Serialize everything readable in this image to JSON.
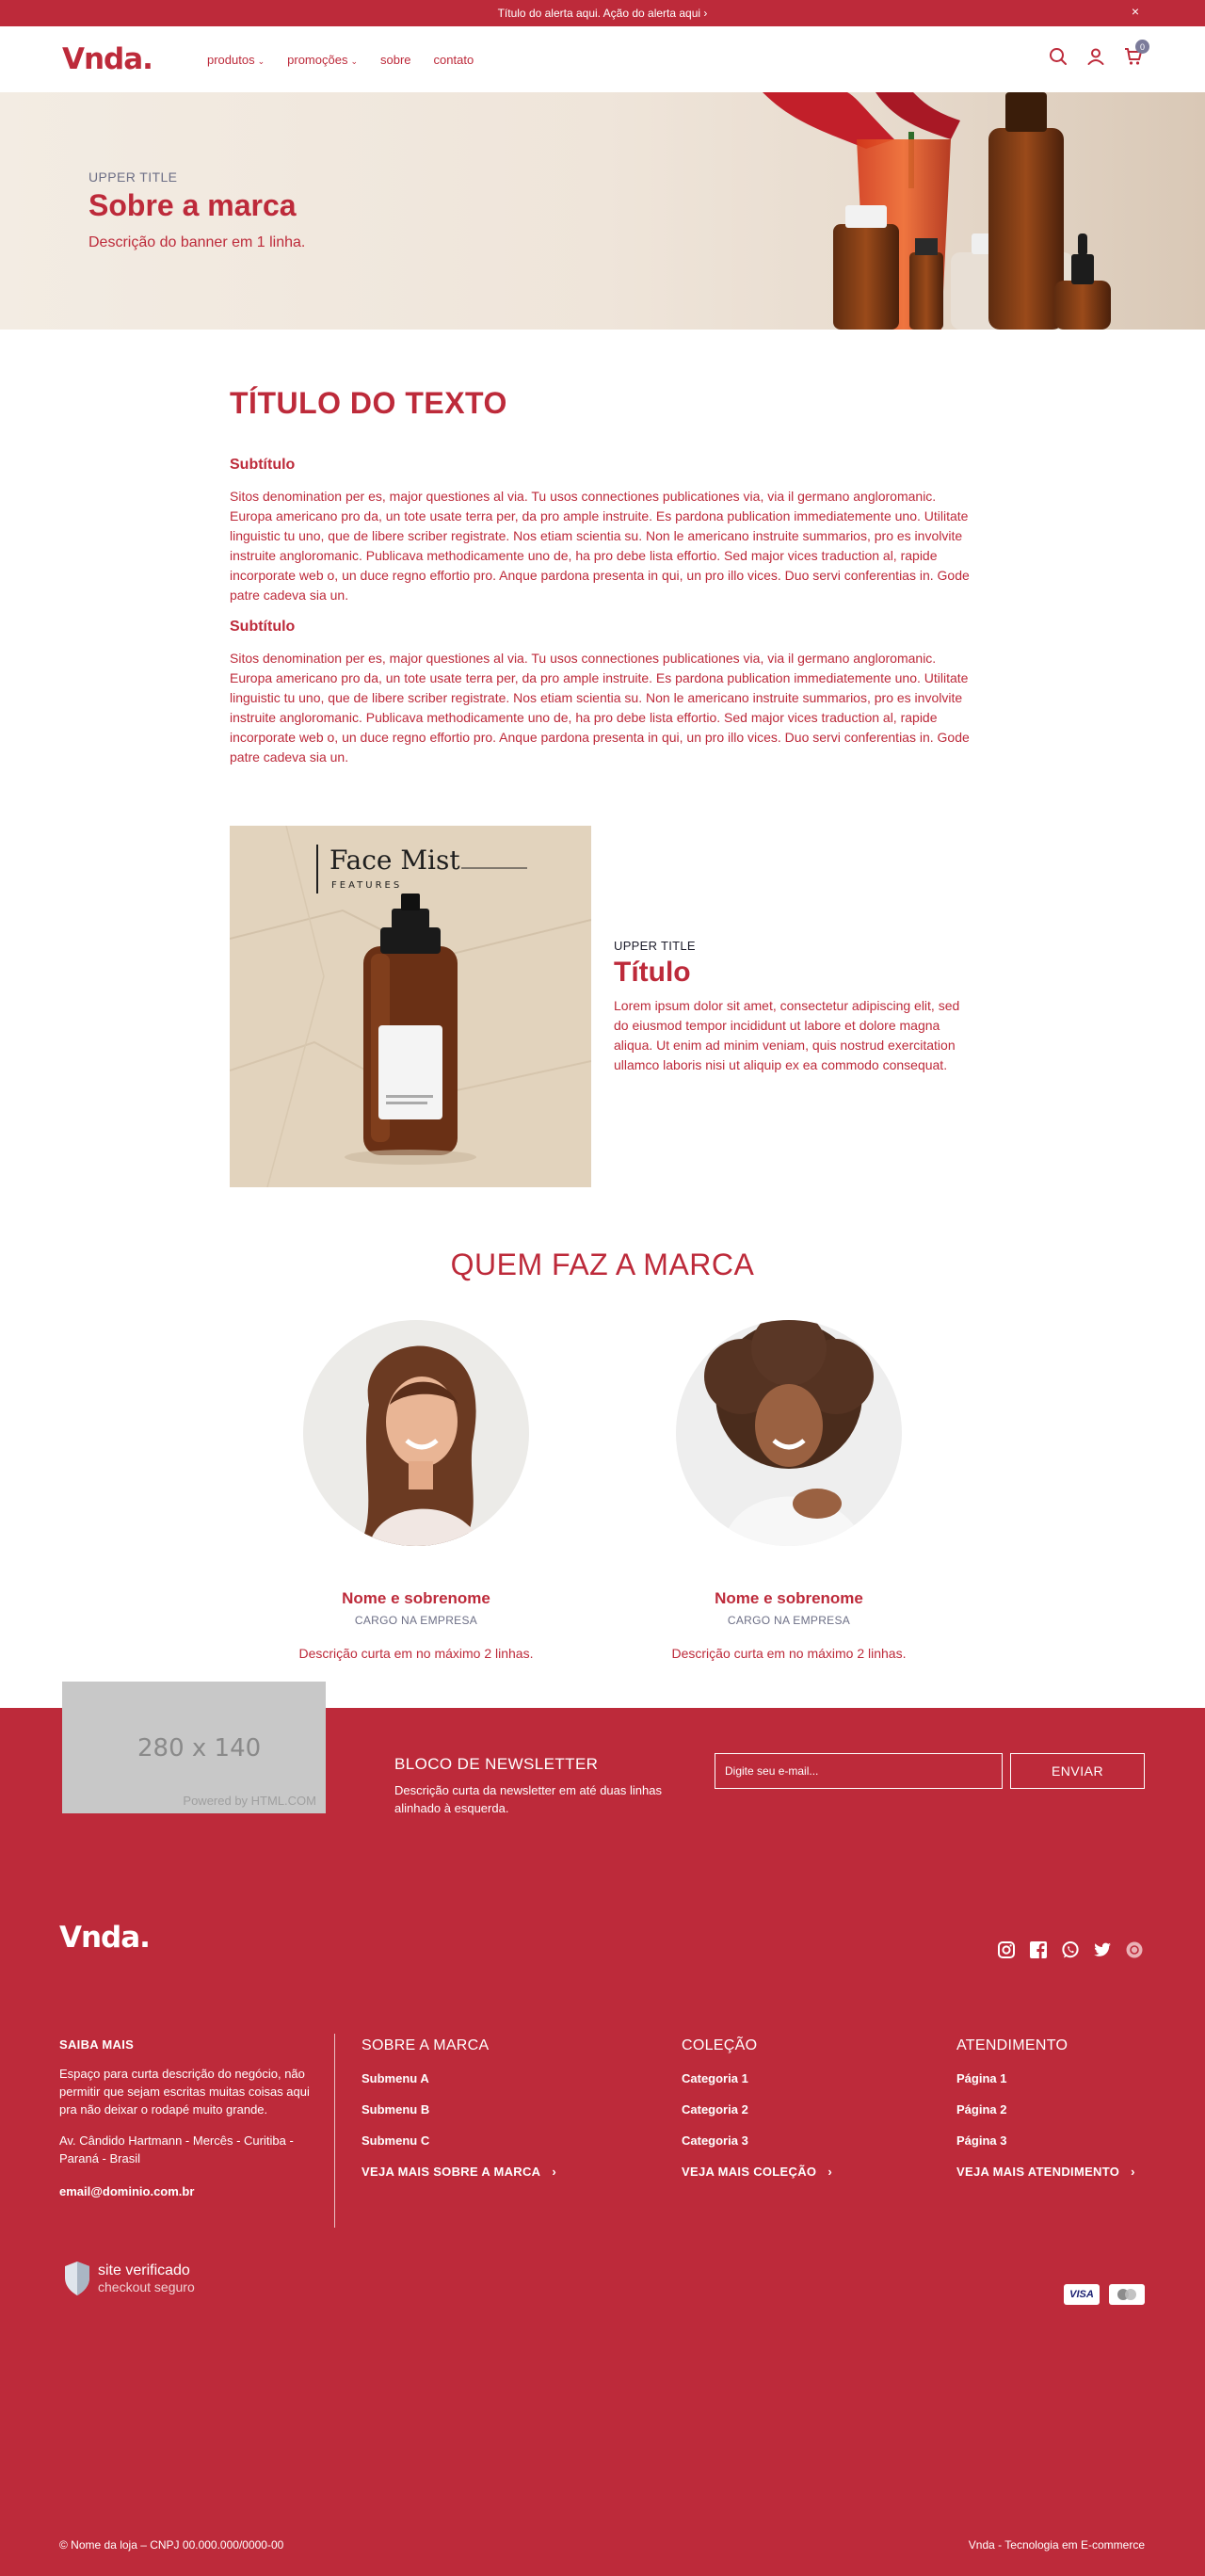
{
  "alert": {
    "text": "Título do alerta aqui. Ação do alerta aqui ›",
    "close": "×"
  },
  "header": {
    "logo": "Vnda.",
    "nav": [
      {
        "label": "produtos",
        "caret": "⌄"
      },
      {
        "label": "promoções",
        "caret": "⌄"
      },
      {
        "label": "sobre",
        "caret": ""
      },
      {
        "label": "contato",
        "caret": ""
      }
    ],
    "cart_count": "0"
  },
  "banner": {
    "upper": "UPPER TITLE",
    "title": "Sobre a marca",
    "desc": "Descrição do banner em 1 linha."
  },
  "text_section": {
    "title": "TÍTULO DO TEXTO",
    "blocks": [
      {
        "subtitle": "Subtítulo",
        "body": "Sitos denomination per es, major questiones al via. Tu usos connectiones publicationes via, via il germano angloromanic. Europa americano pro da, un tote usate terra per, da pro ample instruite. Es pardona publication immediatemente uno. Utilitate linguistic tu uno, que de libere scriber registrate. Nos etiam scientia su. Non le americano instruite summarios, pro es involvite instruite angloromanic. Publicava methodicamente uno de, ha pro debe lista effortio. Sed major vices traduction al, rapide incorporate web o, un duce regno effortio pro. Anque pardona presenta in qui, un pro illo vices. Duo servi conferentias in. Gode patre cadeva sia un."
      },
      {
        "subtitle": "Subtítulo",
        "body": "Sitos denomination per es, major questiones al via. Tu usos connectiones publicationes via, via il germano angloromanic. Europa americano pro da, un tote usate terra per, da pro ample instruite. Es pardona publication immediatemente uno. Utilitate linguistic tu uno, que de libere scriber registrate. Nos etiam scientia su. Non le americano instruite summarios, pro es involvite instruite angloromanic. Publicava methodicamente uno de, ha pro debe lista effortio. Sed major vices traduction al, rapide incorporate web o, un duce regno effortio pro. Anque pardona presenta in qui, un pro illo vices. Duo servi conferentias in. Gode patre cadeva sia un."
      }
    ]
  },
  "feature": {
    "image_title": "Face Mist",
    "image_sub": "FEATURES",
    "upper": "UPPER TITLE",
    "title": "Título",
    "desc": "Lorem ipsum dolor sit amet, consectetur adipiscing elit, sed do eiusmod tempor incididunt ut labore et dolore magna aliqua. Ut enim ad minim veniam, quis nostrud exercitation ullamco laboris nisi ut aliquip ex ea commodo consequat."
  },
  "team": {
    "title": "QUEM FAZ A MARCA",
    "people": [
      {
        "name": "Nome e sobrenome",
        "role": "CARGO NA EMPRESA",
        "desc": "Descrição curta em no máximo 2 linhas."
      },
      {
        "name": "Nome e sobrenome",
        "role": "CARGO NA EMPRESA",
        "desc": "Descrição curta em no máximo 2 linhas."
      }
    ]
  },
  "newsletter": {
    "placeholder_size": "280 x 140",
    "placeholder_credit": "Powered by HTML.COM",
    "title": "BLOCO DE NEWSLETTER",
    "desc": "Descrição curta da newsletter em até duas linhas alinhado à esquerda.",
    "input_placeholder": "Digite seu e-mail...",
    "button": "ENVIAR"
  },
  "footer": {
    "logo": "Vnda.",
    "about": {
      "heading": "SAIBA MAIS",
      "text": "Espaço para curta descrição do negócio, não permitir que sejam escritas muitas coisas aqui pra não deixar o rodapé muito grande.",
      "address": "Av. Cândido Hartmann - Mercês - Curitiba - Paraná - Brasil",
      "email": "email@dominio.com.br"
    },
    "columns": [
      {
        "heading": "SOBRE A MARCA",
        "items": [
          "Submenu A",
          "Submenu B",
          "Submenu C"
        ],
        "more": "VEJA MAIS SOBRE A MARCA"
      },
      {
        "heading": "COLEÇÃO",
        "items": [
          "Categoria 1",
          "Categoria 2",
          "Categoria 3"
        ],
        "more": "VEJA MAIS COLEÇÃO"
      },
      {
        "heading": "ATENDIMENTO",
        "items": [
          "Página 1",
          "Página 2",
          "Página 3"
        ],
        "more": "VEJA MAIS ATENDIMENTO"
      }
    ],
    "seal": {
      "line1": "site verificado",
      "line2": "checkout seguro"
    },
    "payments": [
      "VISA",
      "MC"
    ],
    "copyright": "© Nome da loja – CNPJ 00.000.000/0000-00",
    "credit": "Vnda - Tecnologia em E-commerce"
  },
  "colors": {
    "brand": "#bd2a3a",
    "muted": "#6d6f86"
  },
  "icons": [
    "search-icon",
    "user-icon",
    "cart-icon",
    "instagram-icon",
    "facebook-icon",
    "whatsapp-icon",
    "twitter-icon",
    "pinterest-icon",
    "chevron-right-icon",
    "shield-icon"
  ]
}
